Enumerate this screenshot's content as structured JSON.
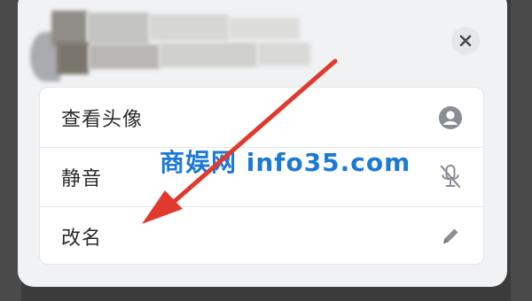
{
  "dialog": {
    "close_label": "×",
    "menu": [
      {
        "label": "查看头像",
        "icon": "avatar-icon"
      },
      {
        "label": "静音",
        "icon": "mic-off-icon"
      },
      {
        "label": "改名",
        "icon": "pencil-icon"
      }
    ]
  },
  "watermark": {
    "text": "商娱网 info35.com",
    "color": "#1c7ad6"
  },
  "annotation": {
    "arrow_color": "#e03a2e",
    "arrow_target": "改名"
  },
  "colors": {
    "sheet_background": "#f1f2f4",
    "card_background": "#ffffff",
    "icon_gray": "#8a8d93"
  }
}
